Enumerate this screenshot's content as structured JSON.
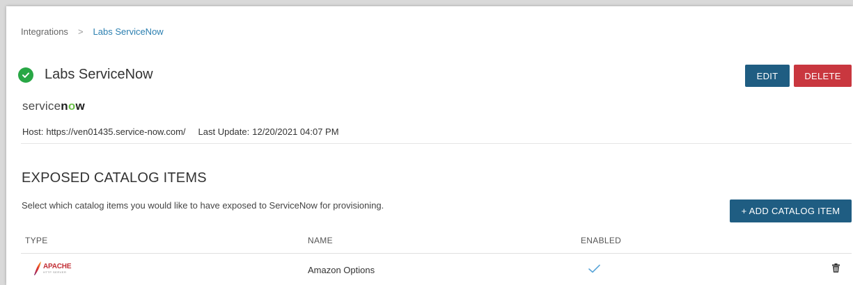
{
  "breadcrumb": {
    "root": "Integrations",
    "separator": ">",
    "current": "Labs ServiceNow"
  },
  "header": {
    "title": "Labs ServiceNow",
    "status_icon": "check-circle-icon",
    "edit_label": "EDIT",
    "delete_label": "DELETE"
  },
  "logo": {
    "prefix": "service",
    "n": "n",
    "o": "o",
    "w": "w"
  },
  "meta": {
    "host_label": "Host:",
    "host_value": "https://ven01435.service-now.com/",
    "update_label": "Last Update:",
    "update_value": "12/20/2021 04:07 PM"
  },
  "catalog": {
    "title": "EXPOSED CATALOG ITEMS",
    "description": "Select which catalog items you would like to have exposed to ServiceNow for provisioning.",
    "add_label": "+ ADD CATALOG ITEM",
    "columns": [
      "TYPE",
      "NAME",
      "ENABLED"
    ],
    "rows": [
      {
        "type_logo": "APACHE",
        "type_sub": "HTTP SERVER",
        "name": "Amazon Options",
        "enabled": true
      }
    ]
  },
  "colors": {
    "primary": "#1f5d82",
    "danger": "#c9373f",
    "success": "#28a745",
    "link": "#2b7fb0"
  }
}
